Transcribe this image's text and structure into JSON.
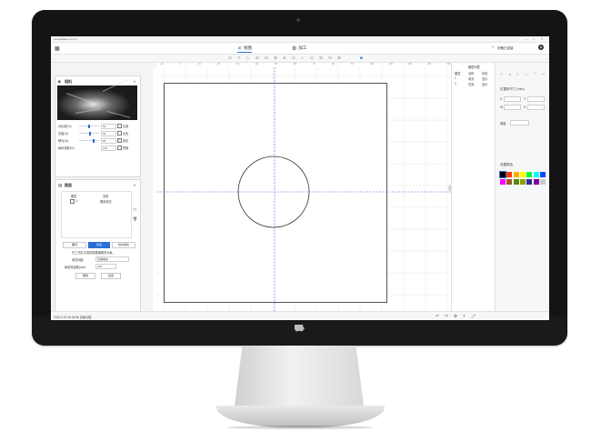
{
  "window": {
    "title": "LaserMaker 1.0.1.0",
    "minimize": "—",
    "maximize": "□",
    "close": "✕"
  },
  "tabs": [
    {
      "label": "绘图",
      "icon": "pen-ruler-icon"
    },
    {
      "label": "加工",
      "icon": "gear-icon"
    }
  ],
  "account": {
    "label": "设备已连接"
  },
  "toolbar": {
    "tools": [
      "⊡",
      "✕",
      "▷",
      "⊞",
      "⊟",
      "⊠",
      "⊕",
      "⊘",
      "≡",
      "⊡",
      "⊞",
      "⊟",
      "⊠"
    ],
    "camera_icon": "camera-icon"
  },
  "ruler": {
    "h_ticks": [
      "-10",
      "0",
      "10",
      "20",
      "30",
      "40",
      "50",
      "60",
      "70",
      "80",
      "90",
      "100",
      "110",
      "120",
      "130",
      "140"
    ]
  },
  "camera_panel": {
    "title": "相机",
    "controls": [
      {
        "label": "对比度(%)",
        "value": "50",
        "pct": 0.5
      },
      {
        "label": "亮度(%)",
        "value": "50",
        "pct": 0.55
      },
      {
        "label": "曝光(%)",
        "value": "80",
        "pct": 0.75
      },
      {
        "label": "每秒线数(%)",
        "value": "100",
        "pct": 1.0
      }
    ],
    "options": [
      {
        "label": "灰度",
        "checked": false
      },
      {
        "label": "反色",
        "checked": false
      },
      {
        "label": "锐化",
        "checked": true
      },
      {
        "label": "镜像",
        "checked": false
      }
    ]
  },
  "layer_panel": {
    "title": "图层",
    "col_layer": "图层",
    "col_name": "名称",
    "row_layer": "1",
    "row_name": "雕刻填充",
    "buttons": {
      "engrave": "雕刻",
      "cut": "切割",
      "other": "线条填充"
    },
    "note": "在工作区中选择需要编辑的对象。",
    "field1_label": "填充间距",
    "field1_value": "扫描填充",
    "field2_label": "每毫米线数(mm)",
    "field2_value": "100",
    "del_button": "删除",
    "apply_button": "应用"
  },
  "right_list": {
    "title": "图层列表",
    "headers": [
      "图层",
      "名称",
      "状态"
    ],
    "rows": [
      [
        "1",
        "填充",
        "显示"
      ],
      [
        "2",
        "切割",
        "显示"
      ]
    ]
  },
  "props_panel": {
    "align_title": "对齐",
    "size_title": "位置和尺寸 (mm)",
    "fields": [
      "X",
      "Y",
      "W",
      "H"
    ],
    "rotate_label": "角度",
    "color_title": "设置颜色"
  },
  "colors": [
    "#000000",
    "#ff3a00",
    "#ffb000",
    "#ffff00",
    "#00ff3a",
    "#00ffff",
    "#0048ff",
    "#ff00ff",
    "#9b5a2a",
    "#5a8a00",
    "#8aa000",
    "#2a2a9b",
    "#7a009b",
    "#c9c9c9"
  ],
  "status": {
    "left": "2019-3-20 16:34:56 高级功能",
    "icons": [
      "undo-icon",
      "redo-icon",
      "settings-icon",
      "help-icon",
      "expand-icon"
    ]
  }
}
